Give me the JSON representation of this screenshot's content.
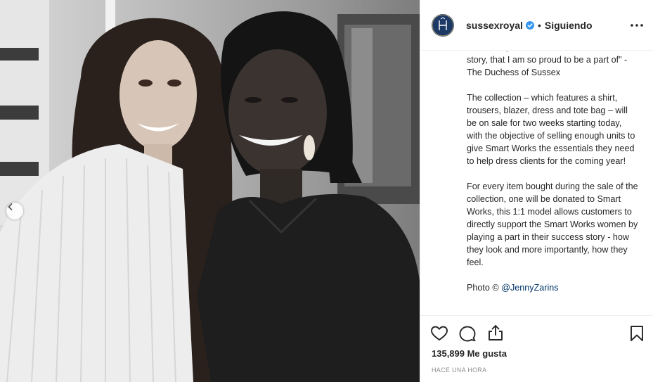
{
  "photo": {
    "alt": "",
    "carousel_prev_icon": "chevron-left-icon"
  },
  "header": {
    "username": "sussexroyal",
    "verified_icon": "verified-badge-icon",
    "separator": "•",
    "follow_label": "Siguiendo",
    "more_icon": "ellipsis-icon",
    "avatar_icon": "monogram-icon"
  },
  "caption": {
    "paragraphs": [
      "another layer to this communal success story, that I am so proud to be a part of\" - The Duchess of Sussex",
      "The collection – which features a shirt, trousers, blazer, dress and tote bag – will be on sale for two weeks starting today, with the objective of selling enough units to give Smart Works the essentials they need to help dress clients for the coming year!",
      "For every item bought during the sale of the collection, one will be donated to Smart Works, this 1:1 model allows customers to directly support the Smart Works women by playing a part in their success story - how they look and more importantly, how they feel."
    ],
    "photo_credit_prefix": "Photo © ",
    "photo_credit_mention": "@JennyZarins"
  },
  "actions": {
    "like_icon": "heart-icon",
    "comment_icon": "comment-icon",
    "share_icon": "share-icon",
    "save_icon": "bookmark-icon",
    "likes_text": "135,899 Me gusta",
    "timestamp": "HACE UNA HORA"
  },
  "colors": {
    "verified_blue": "#3897f0",
    "avatar_navy": "#1d3a67",
    "text": "#262626",
    "muted": "#8e8e8e",
    "link": "#003569"
  }
}
